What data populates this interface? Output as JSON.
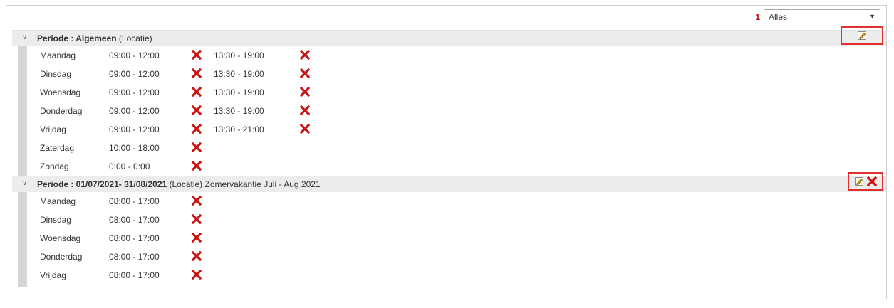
{
  "toolbar": {
    "count": "1",
    "filter_value": "Alles"
  },
  "periods": [
    {
      "title_bold": "Periode : Algemeen",
      "title_rest": " (Locatie)",
      "actions": [
        "edit-icon"
      ],
      "rows": [
        {
          "day": "Maandag",
          "slot1": "09:00 - 12:00",
          "slot2": "13:30 - 19:00"
        },
        {
          "day": "Dinsdag",
          "slot1": "09:00 - 12:00",
          "slot2": "13:30 - 19:00"
        },
        {
          "day": "Woensdag",
          "slot1": "09:00 - 12:00",
          "slot2": "13:30 - 19:00"
        },
        {
          "day": "Donderdag",
          "slot1": "09:00 - 12:00",
          "slot2": "13:30 - 19:00"
        },
        {
          "day": "Vrijdag",
          "slot1": "09:00 - 12:00",
          "slot2": "13:30 - 21:00"
        },
        {
          "day": "Zaterdag",
          "slot1": "10:00 - 18:00",
          "slot2": ""
        },
        {
          "day": "Zondag",
          "slot1": "0:00 - 0:00",
          "slot2": ""
        }
      ]
    },
    {
      "title_bold": "Periode : 01/07/2021- 31/08/2021",
      "title_rest": " (Locatie) Zomervakantie Juli - Aug 2021",
      "actions": [
        "edit-icon",
        "delete-icon"
      ],
      "rows": [
        {
          "day": "Maandag",
          "slot1": "08:00 - 17:00",
          "slot2": ""
        },
        {
          "day": "Dinsdag",
          "slot1": "08:00 - 17:00",
          "slot2": ""
        },
        {
          "day": "Woensdag",
          "slot1": "08:00 - 17:00",
          "slot2": ""
        },
        {
          "day": "Donderdag",
          "slot1": "08:00 - 17:00",
          "slot2": ""
        },
        {
          "day": "Vrijdag",
          "slot1": "08:00 - 17:00",
          "slot2": ""
        }
      ]
    }
  ],
  "colors": {
    "accent_red": "#cc0000",
    "highlight_border": "#e0302f",
    "period_header_bg": "#ececec"
  }
}
